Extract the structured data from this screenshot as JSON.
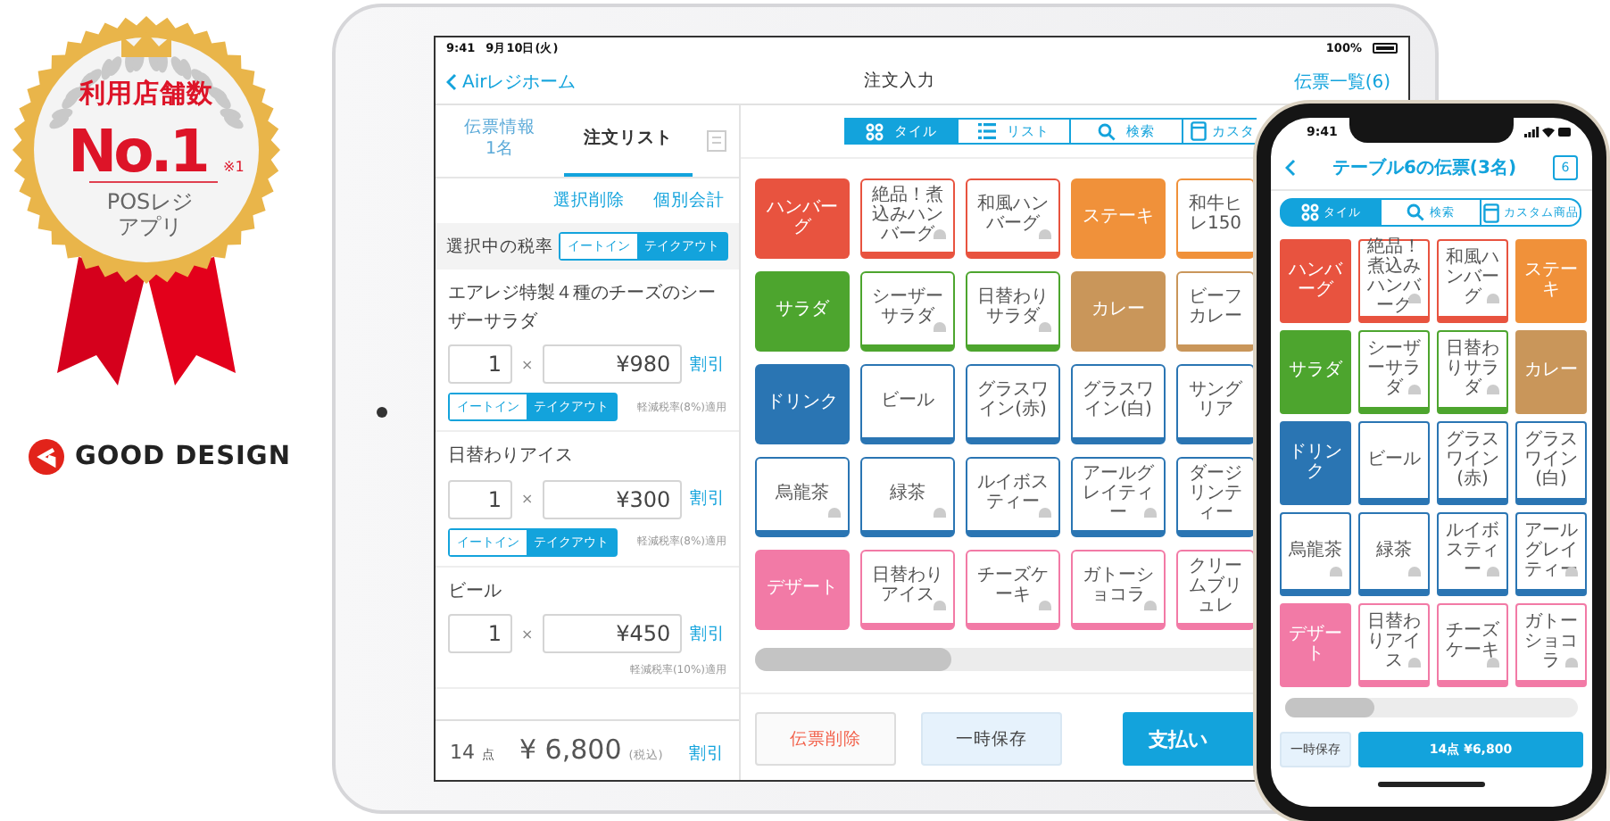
{
  "badge": {
    "heading": "利用店舗数",
    "rank": "No.1",
    "footnote": "※1",
    "caption": [
      "POSレジ",
      "アプリ"
    ]
  },
  "award": {
    "label": "GOOD DESIGN"
  },
  "tablet": {
    "status_bar": {
      "time": "9:41",
      "date": "9月10日(火)",
      "battery": "100%"
    },
    "nav": {
      "back": "Airレジホーム",
      "title": "注文入力",
      "action": "伝票一覧(6)"
    },
    "side_tabs": [
      {
        "label": "伝票情報",
        "sub": "1名",
        "selected": false
      },
      {
        "label": "注文リスト",
        "selected": true
      }
    ],
    "list_actions": [
      "選択削除",
      "個別会計"
    ],
    "tax_rate": {
      "label": "選択中の税率",
      "options": [
        {
          "label": "イートイン",
          "selected": false
        },
        {
          "label": "テイクアウト",
          "selected": true
        }
      ]
    },
    "order_items": [
      {
        "name": "エアレジ特製４種のチーズのシーザーサラダ",
        "quantity": "1",
        "times": "×",
        "price": "¥980",
        "discount": "割引",
        "options": [
          {
            "label": "イートイン",
            "selected": false
          },
          {
            "label": "テイクアウト",
            "selected": true
          }
        ],
        "tax_note": "軽減税率(8%)適用"
      },
      {
        "name": "日替わりアイス",
        "quantity": "1",
        "times": "×",
        "price": "¥300",
        "discount": "割引",
        "options": [
          {
            "label": "イートイン",
            "selected": false
          },
          {
            "label": "テイクアウト",
            "selected": true
          }
        ],
        "tax_note": "軽減税率(8%)適用"
      },
      {
        "name": "ビール",
        "quantity": "1",
        "times": "×",
        "price": "¥450",
        "discount": "割引",
        "tax_note": "軽減税率(10%)適用"
      }
    ],
    "summary": {
      "count": "14",
      "unit": "点",
      "total": "¥ 6,800",
      "tax": "(税込)",
      "discount": "割引"
    },
    "view_tabs": [
      {
        "label": "タイル",
        "kind": "grid",
        "selected": true
      },
      {
        "label": "リスト",
        "kind": "list",
        "selected": false
      },
      {
        "label": "検索",
        "kind": "search",
        "selected": false
      },
      {
        "label": "カスタ",
        "kind": "box",
        "selected": false
      }
    ],
    "tiles": [
      {
        "label": "ハンバーグ",
        "kind": "category",
        "color": "#e8533f"
      },
      {
        "label": "絶品！煮込みハンバーグ",
        "kind": "item",
        "color": "#e8533f",
        "icon": true
      },
      {
        "label": "和風ハンバーグ",
        "kind": "item",
        "color": "#e8533f",
        "icon": true
      },
      {
        "label": "ステーキ",
        "kind": "category",
        "color": "#f0913a"
      },
      {
        "label": "和牛ヒレ150",
        "kind": "item",
        "color": "#f0913a",
        "icon": false
      },
      {
        "label": "サラダ",
        "kind": "category",
        "color": "#4da52e"
      },
      {
        "label": "シーザーサラダ",
        "kind": "item",
        "color": "#4da52e",
        "icon": true
      },
      {
        "label": "日替わりサラダ",
        "kind": "item",
        "color": "#4da52e",
        "icon": true
      },
      {
        "label": "カレー",
        "kind": "category",
        "color": "#c9965a"
      },
      {
        "label": "ビーフカレー",
        "kind": "item",
        "color": "#c9965a",
        "icon": false
      },
      {
        "label": "ドリンク",
        "kind": "category",
        "color": "#2a75b3"
      },
      {
        "label": "ビール",
        "kind": "item",
        "color": "#2a75b3",
        "icon": false
      },
      {
        "label": "グラスワイン(赤)",
        "kind": "item",
        "color": "#2a75b3",
        "icon": false
      },
      {
        "label": "グラスワイン(白)",
        "kind": "item",
        "color": "#2a75b3",
        "icon": false
      },
      {
        "label": "サングリア",
        "kind": "item",
        "color": "#2a75b3",
        "icon": false
      },
      {
        "label": "烏龍茶",
        "kind": "item",
        "color": "#2a75b3",
        "icon": true
      },
      {
        "label": "緑茶",
        "kind": "item",
        "color": "#2a75b3",
        "icon": true
      },
      {
        "label": "ルイボスティー",
        "kind": "item",
        "color": "#2a75b3",
        "icon": true
      },
      {
        "label": "アールグレイティー",
        "kind": "item",
        "color": "#2a75b3",
        "icon": true
      },
      {
        "label": "ダージリンティー",
        "kind": "item",
        "color": "#2a75b3",
        "icon": false
      },
      {
        "label": "デザート",
        "kind": "category",
        "color": "#f27aa6"
      },
      {
        "label": "日替わりアイス",
        "kind": "item",
        "color": "#f27aa6",
        "icon": true
      },
      {
        "label": "チーズケーキ",
        "kind": "item",
        "color": "#f27aa6",
        "icon": true
      },
      {
        "label": "ガトーショコラ",
        "kind": "item",
        "color": "#f27aa6",
        "icon": true
      },
      {
        "label": "クリームブリュレ",
        "kind": "item",
        "color": "#f27aa6",
        "icon": false
      }
    ],
    "buttons": [
      {
        "label": "伝票削除",
        "kind": "danger"
      },
      {
        "label": "一時保存",
        "kind": "secondary"
      },
      {
        "label": "支払い",
        "kind": "primary"
      }
    ]
  },
  "phone": {
    "status_bar": {
      "time": "9:41"
    },
    "nav": {
      "title": "テーブル6の伝票(3名)",
      "badge": "6"
    },
    "view_tabs": [
      {
        "label": "タイル",
        "kind": "grid",
        "selected": true
      },
      {
        "label": "検索",
        "kind": "search",
        "selected": false
      },
      {
        "label": "カスタム商品",
        "kind": "box",
        "selected": false
      }
    ],
    "tiles": [
      {
        "label": "ハンバーグ",
        "kind": "category",
        "color": "#e8533f"
      },
      {
        "label": "絶品！煮込みハンバーグ",
        "kind": "item",
        "color": "#e8533f",
        "icon": true
      },
      {
        "label": "和風ハンバーグ",
        "kind": "item",
        "color": "#e8533f",
        "icon": true
      },
      {
        "label": "ステーキ",
        "kind": "category",
        "color": "#f0913a"
      },
      {
        "label": "サラダ",
        "kind": "category",
        "color": "#4da52e"
      },
      {
        "label": "シーザーサラダ",
        "kind": "item",
        "color": "#4da52e",
        "icon": true
      },
      {
        "label": "日替わりサラダ",
        "kind": "item",
        "color": "#4da52e",
        "icon": true
      },
      {
        "label": "カレー",
        "kind": "category",
        "color": "#c9965a"
      },
      {
        "label": "ドリンク",
        "kind": "category",
        "color": "#2a75b3"
      },
      {
        "label": "ビール",
        "kind": "item",
        "color": "#2a75b3",
        "icon": false
      },
      {
        "label": "グラスワイン(赤)",
        "kind": "item",
        "color": "#2a75b3",
        "icon": false
      },
      {
        "label": "グラスワイン(白)",
        "kind": "item",
        "color": "#2a75b3",
        "icon": false
      },
      {
        "label": "烏龍茶",
        "kind": "item",
        "color": "#2a75b3",
        "icon": true
      },
      {
        "label": "緑茶",
        "kind": "item",
        "color": "#2a75b3",
        "icon": true
      },
      {
        "label": "ルイボスティー",
        "kind": "item",
        "color": "#2a75b3",
        "icon": true
      },
      {
        "label": "アールグレイティー",
        "kind": "item",
        "color": "#2a75b3",
        "icon": true
      },
      {
        "label": "デザート",
        "kind": "category",
        "color": "#f27aa6"
      },
      {
        "label": "日替わりアイス",
        "kind": "item",
        "color": "#f27aa6",
        "icon": true
      },
      {
        "label": "チーズケーキ",
        "kind": "item",
        "color": "#f27aa6",
        "icon": true
      },
      {
        "label": "ガトーショコラ",
        "kind": "item",
        "color": "#f27aa6",
        "icon": true
      }
    ],
    "buttons": [
      {
        "label": "一時保存",
        "kind": "secondary"
      },
      {
        "label": "14点 ¥6,800",
        "kind": "primary"
      }
    ]
  }
}
